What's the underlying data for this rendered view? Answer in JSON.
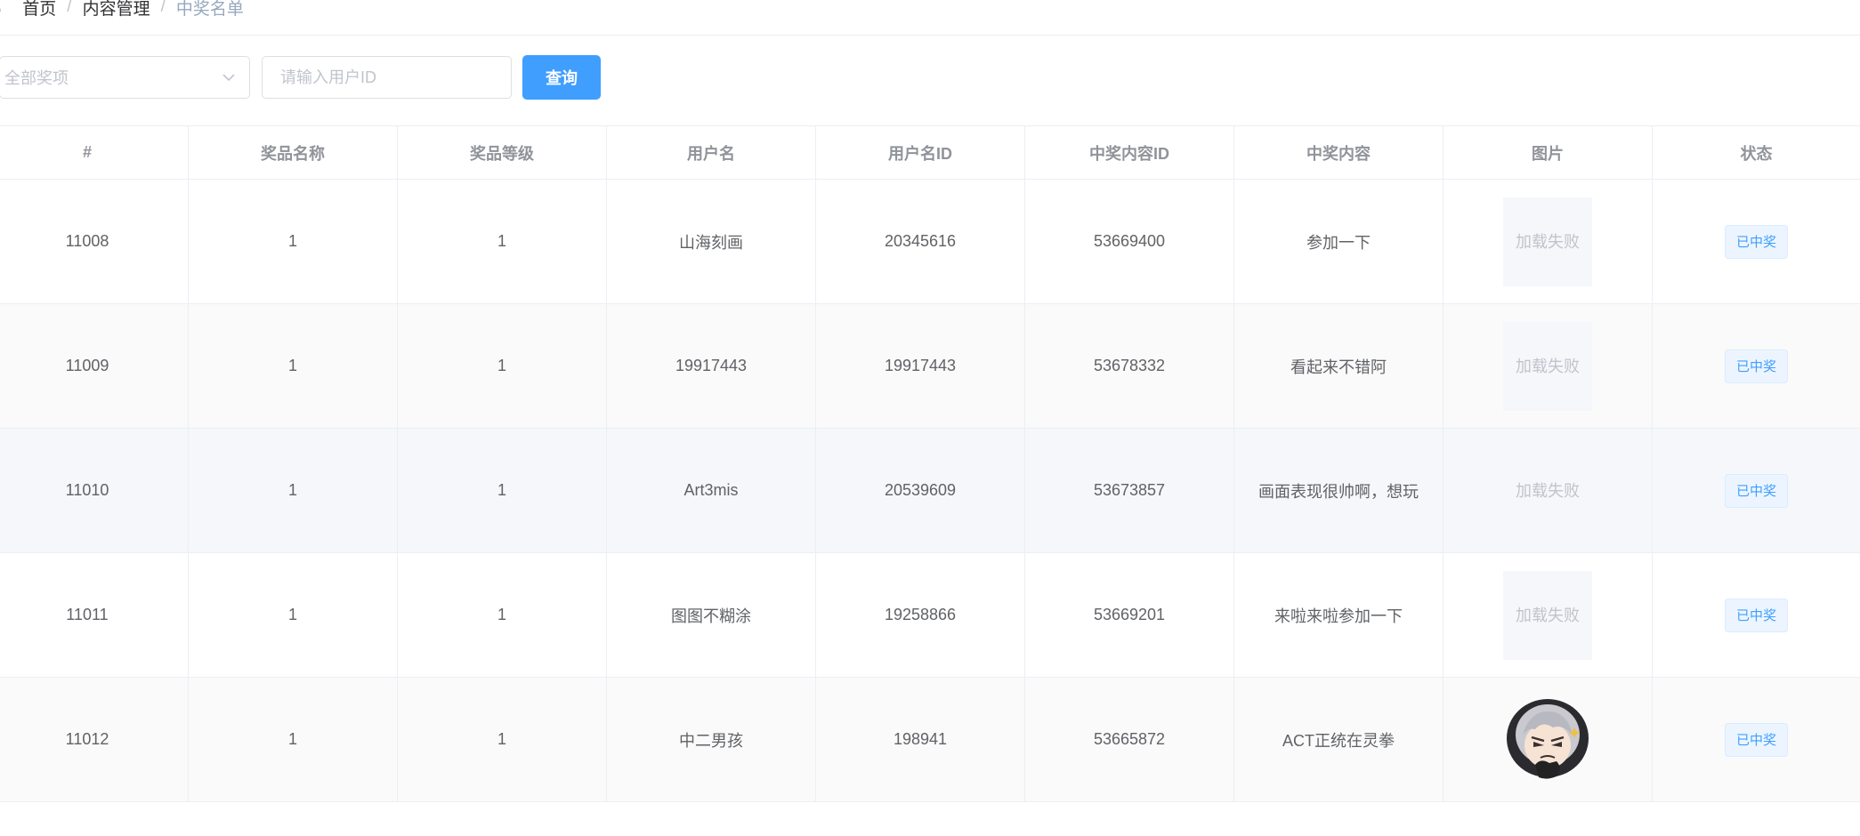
{
  "breadcrumb": {
    "items": [
      "首页",
      "内容管理",
      "中奖名单"
    ],
    "separator": "/"
  },
  "filters": {
    "prize_select": {
      "selected": "全部奖项"
    },
    "user_id_input": {
      "value": "",
      "placeholder": "请输入用户ID"
    },
    "search_label": "查询"
  },
  "table": {
    "headers": [
      "#",
      "奖品名称",
      "奖品等级",
      "用户名",
      "用户名ID",
      "中奖内容ID",
      "中奖内容",
      "图片",
      "状态"
    ],
    "rows": [
      {
        "id": "11008",
        "prize_name": "1",
        "prize_level": "1",
        "username": "山海刻画",
        "user_id": "20345616",
        "content_id": "53669400",
        "content": "参加一下",
        "image": "加载失败",
        "status": "已中奖"
      },
      {
        "id": "11009",
        "prize_name": "1",
        "prize_level": "1",
        "username": "19917443",
        "user_id": "19917443",
        "content_id": "53678332",
        "content": "看起来不错阿",
        "image": "加载失败",
        "status": "已中奖"
      },
      {
        "id": "11010",
        "prize_name": "1",
        "prize_level": "1",
        "username": "Art3mis",
        "user_id": "20539609",
        "content_id": "53673857",
        "content": "画面表现很帅啊，想玩",
        "image": "加载失败",
        "status": "已中奖"
      },
      {
        "id": "11011",
        "prize_name": "1",
        "prize_level": "1",
        "username": "图图不糊涂",
        "user_id": "19258866",
        "content_id": "53669201",
        "content": "来啦来啦参加一下",
        "image": "加载失败",
        "status": "已中奖"
      },
      {
        "id": "11012",
        "prize_name": "1",
        "prize_level": "1",
        "username": "中二男孩",
        "user_id": "198941",
        "content_id": "53665872",
        "content": "ACT正统在灵拳",
        "image": "avatar-image",
        "status": "已中奖"
      }
    ]
  },
  "colors": {
    "primary": "#409eff",
    "border": "#ebeef5",
    "text": "#606266",
    "header_text": "#909399",
    "placeholder": "#c0c4cc"
  }
}
